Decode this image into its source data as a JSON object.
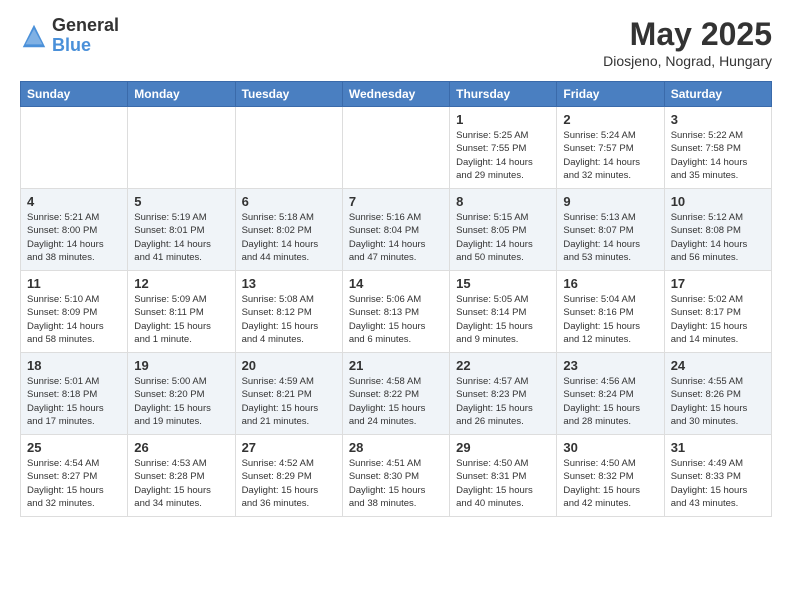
{
  "header": {
    "title": "May 2025",
    "subtitle": "Diosjeno, Nograd, Hungary",
    "logo_line1": "General",
    "logo_line2": "Blue"
  },
  "days_of_week": [
    "Sunday",
    "Monday",
    "Tuesday",
    "Wednesday",
    "Thursday",
    "Friday",
    "Saturday"
  ],
  "weeks": [
    [
      {
        "num": "",
        "detail": ""
      },
      {
        "num": "",
        "detail": ""
      },
      {
        "num": "",
        "detail": ""
      },
      {
        "num": "",
        "detail": ""
      },
      {
        "num": "1",
        "detail": "Sunrise: 5:25 AM\nSunset: 7:55 PM\nDaylight: 14 hours and 29 minutes."
      },
      {
        "num": "2",
        "detail": "Sunrise: 5:24 AM\nSunset: 7:57 PM\nDaylight: 14 hours and 32 minutes."
      },
      {
        "num": "3",
        "detail": "Sunrise: 5:22 AM\nSunset: 7:58 PM\nDaylight: 14 hours and 35 minutes."
      }
    ],
    [
      {
        "num": "4",
        "detail": "Sunrise: 5:21 AM\nSunset: 8:00 PM\nDaylight: 14 hours and 38 minutes."
      },
      {
        "num": "5",
        "detail": "Sunrise: 5:19 AM\nSunset: 8:01 PM\nDaylight: 14 hours and 41 minutes."
      },
      {
        "num": "6",
        "detail": "Sunrise: 5:18 AM\nSunset: 8:02 PM\nDaylight: 14 hours and 44 minutes."
      },
      {
        "num": "7",
        "detail": "Sunrise: 5:16 AM\nSunset: 8:04 PM\nDaylight: 14 hours and 47 minutes."
      },
      {
        "num": "8",
        "detail": "Sunrise: 5:15 AM\nSunset: 8:05 PM\nDaylight: 14 hours and 50 minutes."
      },
      {
        "num": "9",
        "detail": "Sunrise: 5:13 AM\nSunset: 8:07 PM\nDaylight: 14 hours and 53 minutes."
      },
      {
        "num": "10",
        "detail": "Sunrise: 5:12 AM\nSunset: 8:08 PM\nDaylight: 14 hours and 56 minutes."
      }
    ],
    [
      {
        "num": "11",
        "detail": "Sunrise: 5:10 AM\nSunset: 8:09 PM\nDaylight: 14 hours and 58 minutes."
      },
      {
        "num": "12",
        "detail": "Sunrise: 5:09 AM\nSunset: 8:11 PM\nDaylight: 15 hours and 1 minute."
      },
      {
        "num": "13",
        "detail": "Sunrise: 5:08 AM\nSunset: 8:12 PM\nDaylight: 15 hours and 4 minutes."
      },
      {
        "num": "14",
        "detail": "Sunrise: 5:06 AM\nSunset: 8:13 PM\nDaylight: 15 hours and 6 minutes."
      },
      {
        "num": "15",
        "detail": "Sunrise: 5:05 AM\nSunset: 8:14 PM\nDaylight: 15 hours and 9 minutes."
      },
      {
        "num": "16",
        "detail": "Sunrise: 5:04 AM\nSunset: 8:16 PM\nDaylight: 15 hours and 12 minutes."
      },
      {
        "num": "17",
        "detail": "Sunrise: 5:02 AM\nSunset: 8:17 PM\nDaylight: 15 hours and 14 minutes."
      }
    ],
    [
      {
        "num": "18",
        "detail": "Sunrise: 5:01 AM\nSunset: 8:18 PM\nDaylight: 15 hours and 17 minutes."
      },
      {
        "num": "19",
        "detail": "Sunrise: 5:00 AM\nSunset: 8:20 PM\nDaylight: 15 hours and 19 minutes."
      },
      {
        "num": "20",
        "detail": "Sunrise: 4:59 AM\nSunset: 8:21 PM\nDaylight: 15 hours and 21 minutes."
      },
      {
        "num": "21",
        "detail": "Sunrise: 4:58 AM\nSunset: 8:22 PM\nDaylight: 15 hours and 24 minutes."
      },
      {
        "num": "22",
        "detail": "Sunrise: 4:57 AM\nSunset: 8:23 PM\nDaylight: 15 hours and 26 minutes."
      },
      {
        "num": "23",
        "detail": "Sunrise: 4:56 AM\nSunset: 8:24 PM\nDaylight: 15 hours and 28 minutes."
      },
      {
        "num": "24",
        "detail": "Sunrise: 4:55 AM\nSunset: 8:26 PM\nDaylight: 15 hours and 30 minutes."
      }
    ],
    [
      {
        "num": "25",
        "detail": "Sunrise: 4:54 AM\nSunset: 8:27 PM\nDaylight: 15 hours and 32 minutes."
      },
      {
        "num": "26",
        "detail": "Sunrise: 4:53 AM\nSunset: 8:28 PM\nDaylight: 15 hours and 34 minutes."
      },
      {
        "num": "27",
        "detail": "Sunrise: 4:52 AM\nSunset: 8:29 PM\nDaylight: 15 hours and 36 minutes."
      },
      {
        "num": "28",
        "detail": "Sunrise: 4:51 AM\nSunset: 8:30 PM\nDaylight: 15 hours and 38 minutes."
      },
      {
        "num": "29",
        "detail": "Sunrise: 4:50 AM\nSunset: 8:31 PM\nDaylight: 15 hours and 40 minutes."
      },
      {
        "num": "30",
        "detail": "Sunrise: 4:50 AM\nSunset: 8:32 PM\nDaylight: 15 hours and 42 minutes."
      },
      {
        "num": "31",
        "detail": "Sunrise: 4:49 AM\nSunset: 8:33 PM\nDaylight: 15 hours and 43 minutes."
      }
    ]
  ]
}
